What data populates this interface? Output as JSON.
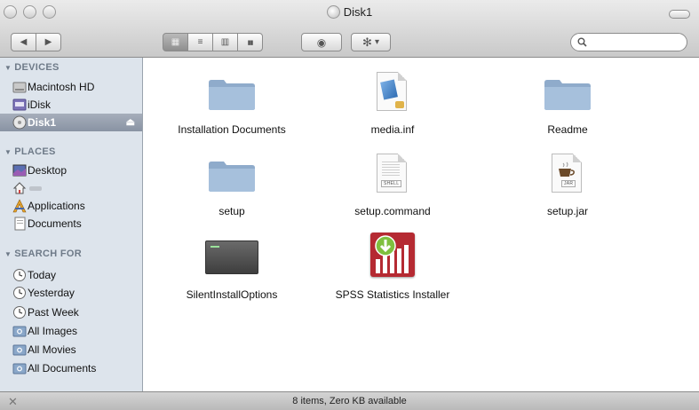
{
  "window": {
    "title": "Disk1"
  },
  "toolbar": {
    "back_icon": "◀",
    "forward_icon": "▶",
    "view_icon_glyph": "▦",
    "view_list_glyph": "≡",
    "view_column_glyph": "▥",
    "view_cover_glyph": "▮▮",
    "quicklook_glyph": "◉",
    "action_glyph": "✻",
    "action_caret": "▾",
    "search_value": "",
    "search_placeholder": ""
  },
  "sidebar": {
    "devices": {
      "header": "DEVICES",
      "items": [
        {
          "label": "Macintosh HD",
          "icon": "hard-drive-icon"
        },
        {
          "label": "iDisk",
          "icon": "idisk-icon"
        },
        {
          "label": "Disk1",
          "icon": "disk-icon",
          "selected": true
        }
      ],
      "eject": "⏏"
    },
    "places": {
      "header": "PLACES",
      "items": [
        {
          "label": "Desktop",
          "icon": "desktop-icon"
        },
        {
          "label": "",
          "icon": "home-icon"
        },
        {
          "label": "Applications",
          "icon": "applications-icon"
        },
        {
          "label": "Documents",
          "icon": "documents-icon"
        }
      ]
    },
    "search_for": {
      "header": "SEARCH FOR",
      "items": [
        {
          "label": "Today",
          "icon": "clock-icon"
        },
        {
          "label": "Yesterday",
          "icon": "clock-icon"
        },
        {
          "label": "Past Week",
          "icon": "clock-icon"
        },
        {
          "label": "All Images",
          "icon": "smart-folder-icon"
        },
        {
          "label": "All Movies",
          "icon": "smart-folder-icon"
        },
        {
          "label": "All Documents",
          "icon": "smart-folder-icon"
        }
      ]
    }
  },
  "files": [
    {
      "name": "Installation Documents",
      "icon": "folder-icon"
    },
    {
      "name": "media.inf",
      "icon": "inf-file-icon"
    },
    {
      "name": "Readme",
      "icon": "folder-icon"
    },
    {
      "name": "setup",
      "icon": "folder-icon"
    },
    {
      "name": "setup.command",
      "icon": "shell-script-icon",
      "tag": "SHELL"
    },
    {
      "name": "setup.jar",
      "icon": "jar-file-icon",
      "tag": "JAR"
    },
    {
      "name": "SilentInstallOptions",
      "icon": "terminal-file-icon"
    },
    {
      "name": "SPSS Statistics Installer",
      "icon": "spss-installer-icon"
    }
  ],
  "status": {
    "text": "8 items, Zero KB available",
    "close_glyph": "✕"
  },
  "colors": {
    "sidebar_bg": "#dde4ec",
    "sidebar_header": "#6e7a88",
    "selection": "#8993a3",
    "folder_blue": "#9fbad6",
    "spss_red": "#b52a32"
  }
}
